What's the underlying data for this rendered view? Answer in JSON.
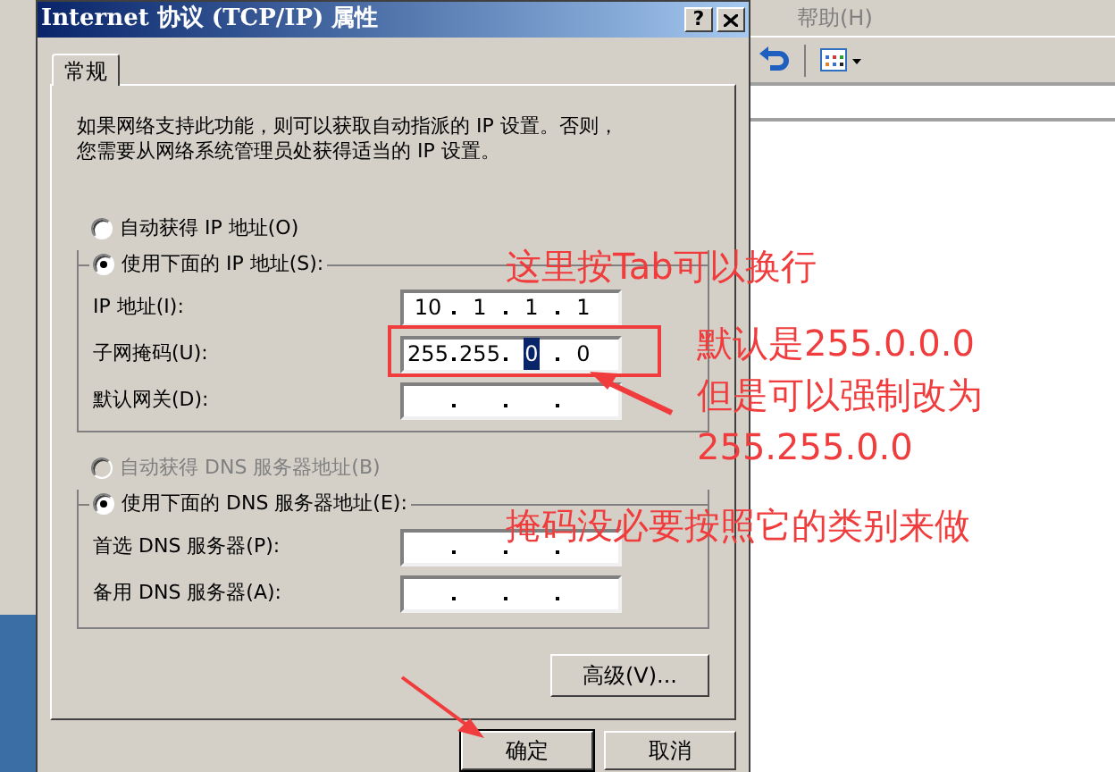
{
  "background_window": {
    "menu": [
      {
        "label": "帮助(H)"
      }
    ]
  },
  "dialog": {
    "title": "Internet 协议 (TCP/IP) 属性",
    "help_button": "?",
    "tabs": [
      {
        "label": "常规",
        "selected": true
      }
    ],
    "description_lines": [
      "如果网络支持此功能，则可以获取自动指派的 IP 设置。否则，",
      "您需要从网络系统管理员处获得适当的 IP 设置。"
    ],
    "ip_mode": [
      {
        "label": "自动获得 IP 地址(O)",
        "selected": false,
        "disabled": false
      },
      {
        "label": "使用下面的 IP 地址(S):",
        "selected": true,
        "disabled": false
      }
    ],
    "ip_fields": [
      {
        "label": "IP 地址(I):",
        "octets": [
          {
            "text": "10",
            "selected": false
          },
          {
            "text": "1",
            "selected": false
          },
          {
            "text": "1",
            "selected": false
          },
          {
            "text": "1",
            "selected": false
          }
        ]
      },
      {
        "label": "子网掩码(U):",
        "octets": [
          {
            "text": "255",
            "selected": false
          },
          {
            "text": "255",
            "selected": false
          },
          {
            "text": "0",
            "selected": true
          },
          {
            "text": "0",
            "selected": false
          }
        ]
      },
      {
        "label": "默认网关(D):"
      }
    ],
    "dns_mode": [
      {
        "label": "自动获得 DNS 服务器地址(B)",
        "selected": false,
        "disabled": true
      },
      {
        "label": "使用下面的 DNS 服务器地址(E):",
        "selected": true,
        "disabled": false
      }
    ],
    "dns_fields": [
      {
        "label": "首选 DNS 服务器(P):"
      },
      {
        "label": "备用 DNS 服务器(A):"
      }
    ],
    "advanced_button": "高级(V)...",
    "buttons": [
      {
        "label": "确定",
        "default": true
      },
      {
        "label": "取消",
        "default": false
      }
    ]
  },
  "annotations": [
    {
      "lines": [
        "这里按Tab可以换行"
      ]
    },
    {
      "lines": [
        "默认是255.0.0.0",
        "但是可以强制改为",
        "255.255.0.0"
      ]
    },
    {
      "lines": [
        "掩码没必要按照它的类别来做"
      ]
    }
  ]
}
